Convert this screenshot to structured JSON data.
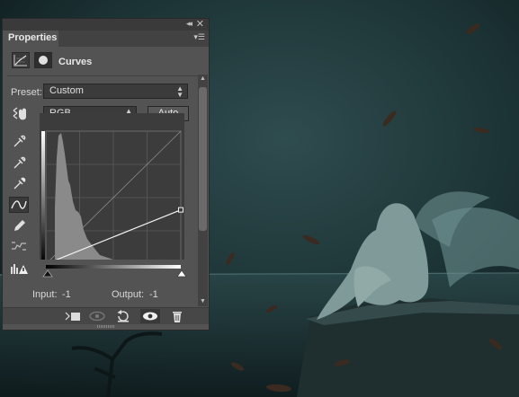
{
  "panel": {
    "tab_label": "Properties",
    "title": "Curves",
    "preset_label": "Preset:",
    "preset_value": "Custom",
    "channel_value": "RGB",
    "auto_label": "Auto",
    "input_label": "Input:",
    "input_value": "-1",
    "output_label": "Output:",
    "output_value": "-1"
  },
  "curve": {
    "points": [
      {
        "input": 0,
        "output": 0
      },
      {
        "input": 255,
        "output": 104
      }
    ],
    "histogram_color": "#8a8a8a"
  },
  "icons": {
    "collapse": "double-chevron-icon",
    "close": "close-icon",
    "panel_menu": "panel-menu-icon",
    "adjustment": "curves-adjustment-icon",
    "mask": "layer-mask-icon",
    "target_hand": "on-image-adjust-icon",
    "tools": [
      "black-point-eyedropper-icon",
      "gray-point-eyedropper-icon",
      "white-point-eyedropper-icon",
      "curve-points-icon",
      "pencil-draw-icon",
      "smooth-curve-icon",
      "clipping-warning-icon"
    ],
    "bottom": [
      "clip-to-layer-icon",
      "view-previous-icon",
      "reset-icon",
      "visibility-eye-icon",
      "trash-icon"
    ]
  },
  "colors": {
    "panel_bg": "#535353",
    "scene_dark": "#142628",
    "scene_mid": "#3a5a5c"
  }
}
